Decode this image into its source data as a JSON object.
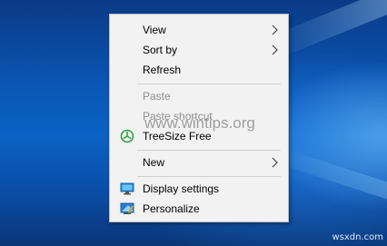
{
  "context_menu": {
    "items": [
      {
        "label": "View",
        "has_submenu": true
      },
      {
        "label": "Sort by",
        "has_submenu": true
      },
      {
        "label": "Refresh"
      },
      {
        "label": "Paste",
        "disabled": true
      },
      {
        "label": "Paste shortcut",
        "disabled": true
      },
      {
        "label": "TreeSize Free",
        "icon": "treesize-icon"
      },
      {
        "label": "New",
        "has_submenu": true
      },
      {
        "label": "Display settings",
        "icon": "display-settings-icon"
      },
      {
        "label": "Personalize",
        "icon": "personalize-icon"
      }
    ]
  },
  "watermark": "www.wintips.org",
  "footer": "wsxdn.com",
  "colors": {
    "menu_bg": "#f2f2f2",
    "disabled_text": "#8f8f8f",
    "desktop_blue": "#0a56b4",
    "treesize_green": "#2ea043"
  }
}
